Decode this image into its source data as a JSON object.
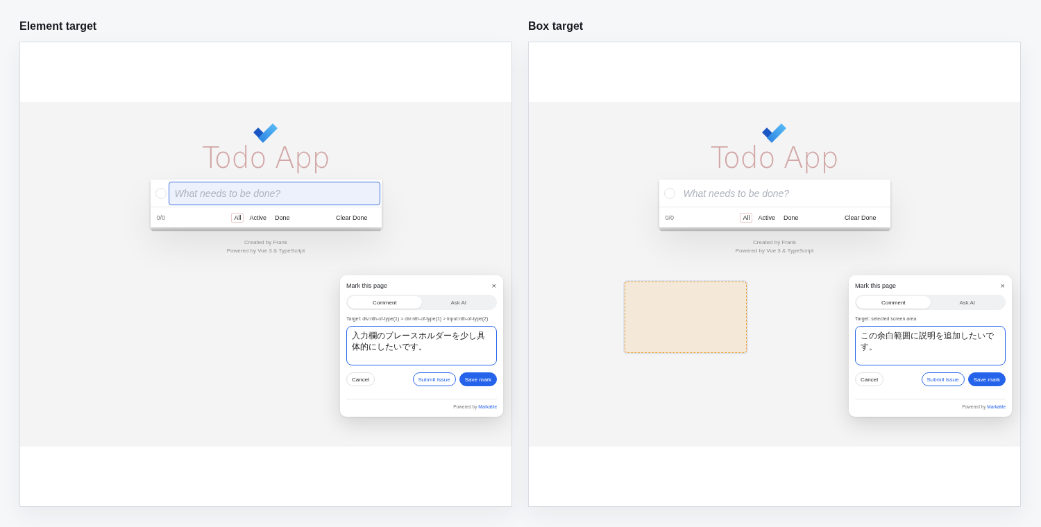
{
  "panels": [
    {
      "title": "Element target",
      "selection_box": false,
      "app": {
        "title": "Todo App",
        "input_highlighted": true,
        "placeholder": "What needs to be done?",
        "count": "0/0",
        "filters": [
          {
            "label": "All",
            "selected": true
          },
          {
            "label": "Active",
            "selected": false
          },
          {
            "label": "Done",
            "selected": false
          }
        ],
        "clear": "Clear Done",
        "credits": [
          "Created by Frank",
          "Powered by Vue 3 & TypeScript"
        ]
      },
      "dialog": {
        "title": "Mark this page",
        "close": "×",
        "tabs": [
          {
            "label": "Comment",
            "selected": true
          },
          {
            "label": "Ask AI",
            "selected": false
          }
        ],
        "target": "Target: div:nth-of-type(1) > div:nth-of-type(1) > input:nth-of-type(2)",
        "comment": "入力欄のプレースホルダーを少し具体的にしたいです。",
        "buttons": [
          {
            "label": "Cancel",
            "kind": "secondary"
          },
          {
            "label": "Submit Issue",
            "kind": "outline"
          },
          {
            "label": "Save mark",
            "kind": "primary"
          }
        ],
        "footer": {
          "text": "Powered by",
          "link": "Markable"
        }
      }
    },
    {
      "title": "Box target",
      "selection_box": true,
      "app": {
        "title": "Todo App",
        "input_highlighted": false,
        "placeholder": "What needs to be done?",
        "count": "0/0",
        "filters": [
          {
            "label": "All",
            "selected": true
          },
          {
            "label": "Active",
            "selected": false
          },
          {
            "label": "Done",
            "selected": false
          }
        ],
        "clear": "Clear Done",
        "credits": [
          "Created by Frank",
          "Powered by Vue 3 & TypeScript"
        ]
      },
      "dialog": {
        "title": "Mark this page",
        "close": "×",
        "tabs": [
          {
            "label": "Comment",
            "selected": true
          },
          {
            "label": "Ask AI",
            "selected": false
          }
        ],
        "target": "Target: selected screen area",
        "comment": "この余白範囲に説明を追加したいです。",
        "buttons": [
          {
            "label": "Cancel",
            "kind": "secondary"
          },
          {
            "label": "Submit Issue",
            "kind": "outline"
          },
          {
            "label": "Save mark",
            "kind": "primary"
          }
        ],
        "footer": {
          "text": "Powered by",
          "link": "Markable"
        }
      }
    }
  ]
}
